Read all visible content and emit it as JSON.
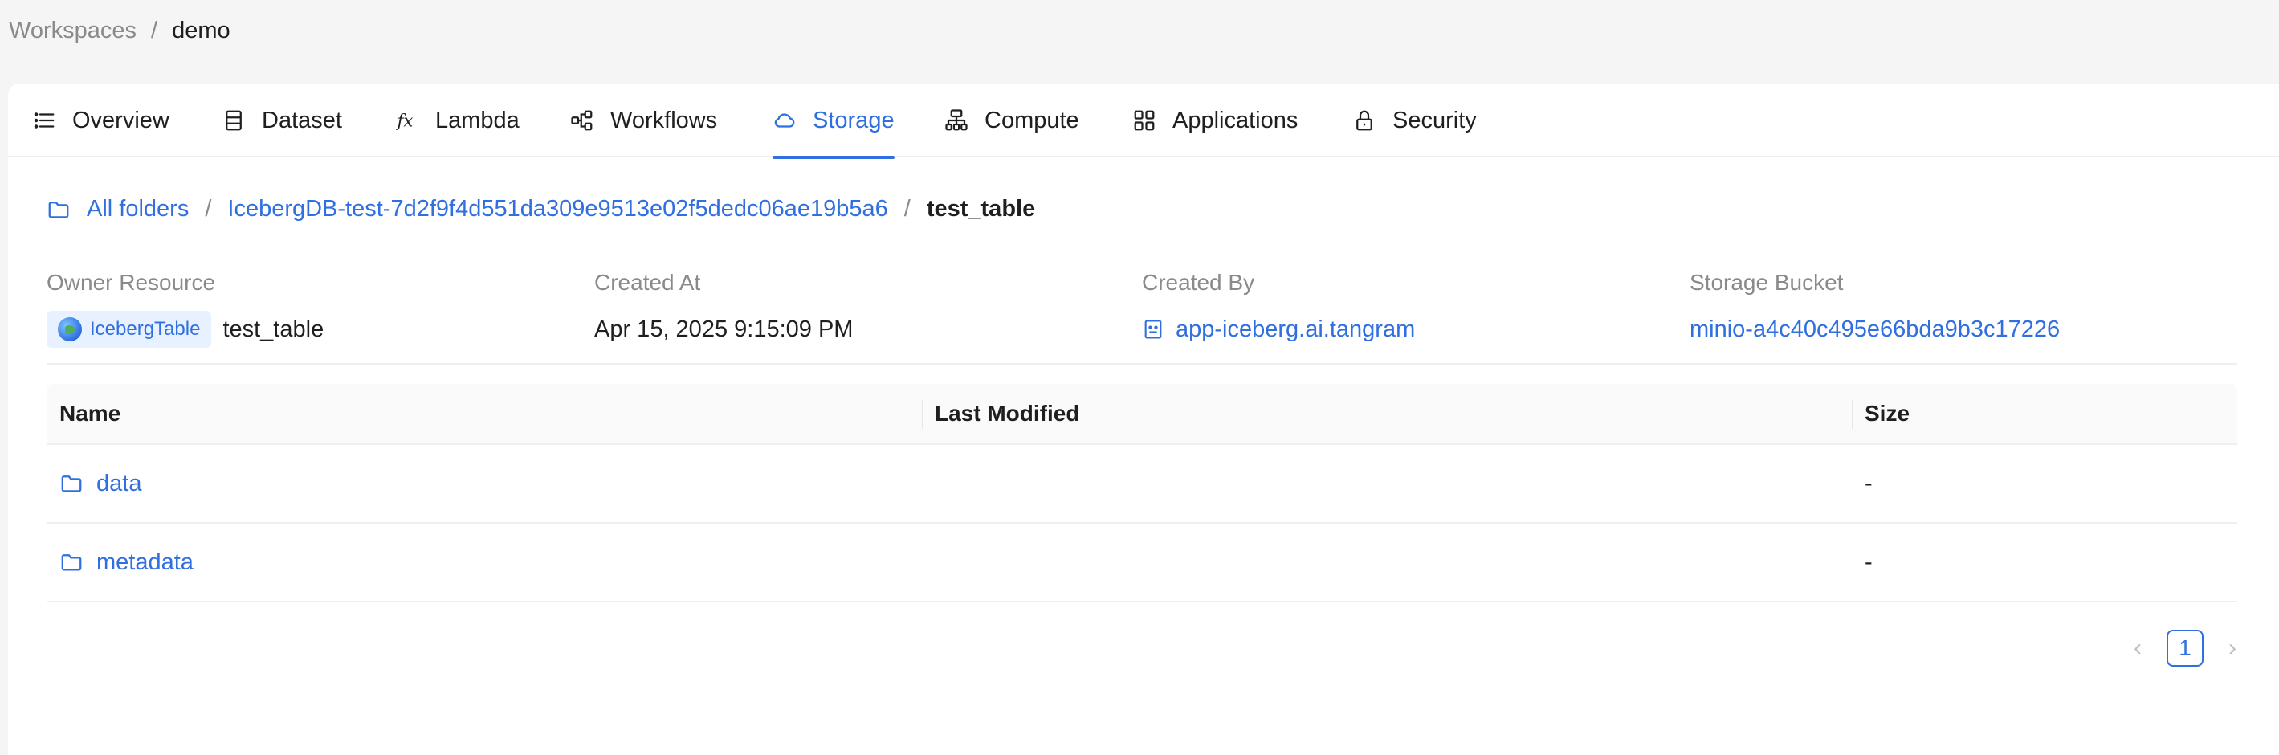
{
  "top_breadcrumb": {
    "root": "Workspaces",
    "separator": "/",
    "current": "demo"
  },
  "tabs": [
    {
      "label": "Overview",
      "icon": "list-icon"
    },
    {
      "label": "Dataset",
      "icon": "dataset-icon"
    },
    {
      "label": "Lambda",
      "icon": "fx-icon"
    },
    {
      "label": "Workflows",
      "icon": "workflow-icon"
    },
    {
      "label": "Storage",
      "icon": "cloud-icon",
      "active": true
    },
    {
      "label": "Compute",
      "icon": "compute-icon"
    },
    {
      "label": "Applications",
      "icon": "apps-icon"
    },
    {
      "label": "Security",
      "icon": "lock-icon"
    }
  ],
  "path": {
    "all_folders": "All folders",
    "separator": "/",
    "parent": "IcebergDB-test-7d2f9f4d551da309e9513e02f5dedc06ae19b5a6",
    "current": "test_table"
  },
  "meta": {
    "owner_resource": {
      "label": "Owner Resource",
      "tag": "IcebergTable",
      "value": "test_table"
    },
    "created_at": {
      "label": "Created At",
      "value": "Apr 15, 2025 9:15:09 PM"
    },
    "created_by": {
      "label": "Created By",
      "value": "app-iceberg.ai.tangram"
    },
    "storage_bucket": {
      "label": "Storage Bucket",
      "value": "minio-a4c40c495e66bda9b3c17226"
    }
  },
  "table": {
    "headers": [
      "Name",
      "Last Modified",
      "Size"
    ],
    "rows": [
      {
        "name": "data",
        "last_modified": "",
        "size": "-"
      },
      {
        "name": "metadata",
        "last_modified": "",
        "size": "-"
      }
    ]
  },
  "pagination": {
    "current_page": "1",
    "prev": "‹",
    "next": "›"
  },
  "colors": {
    "accent": "#2f6fe0",
    "muted": "#8a8a8a"
  }
}
